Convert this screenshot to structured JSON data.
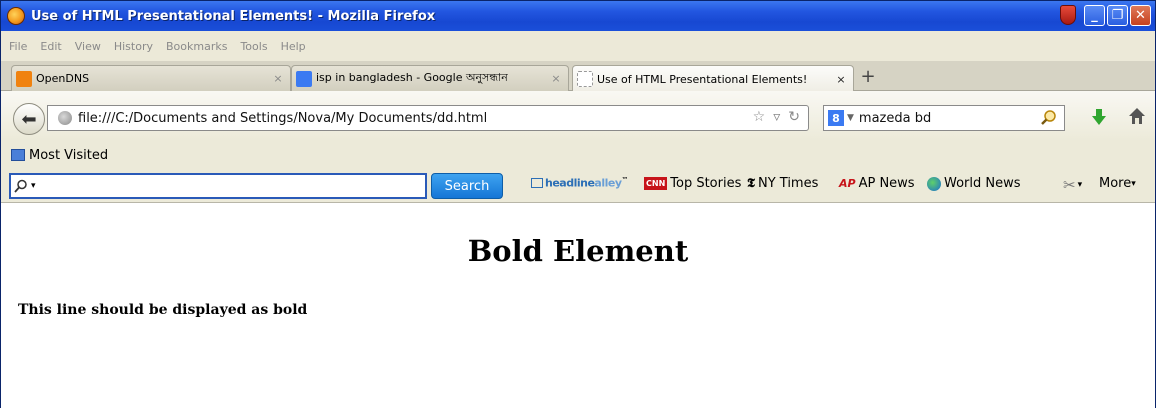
{
  "window": {
    "title": "Use of HTML Presentational Elements! - Mozilla Firefox"
  },
  "menu": {
    "items": [
      "File",
      "Edit",
      "View",
      "History",
      "Bookmarks",
      "Tools",
      "Help"
    ]
  },
  "tabs": [
    {
      "label": "OpenDNS",
      "close": "×"
    },
    {
      "label": "isp in bangladesh - Google অনুসন্ধান",
      "close": "×"
    },
    {
      "label": "Use of HTML Presentational Elements!",
      "close": "×"
    }
  ],
  "newtab": "+",
  "nav": {
    "url": "file:///C:/Documents and Settings/Nova/My Documents/dd.html",
    "search_engine": "8",
    "search_value": "mazeda bd"
  },
  "bookmarks": {
    "most_visited": "Most Visited"
  },
  "toolbar": {
    "search_drop": "▾",
    "search_button": "Search",
    "headline_a": "headline",
    "headline_b": "alley",
    "headline_tm": "™",
    "cnn_badge": "CNN",
    "top_stories": "Top Stories",
    "nyt_glyph": "𝕿",
    "ny_times": "NY Times",
    "ap_badge": "AP",
    "ap_news": "AP News",
    "world_news": "World News",
    "more": "More"
  },
  "content": {
    "heading": "Bold Element",
    "paragraph": "This line should be displayed as bold"
  },
  "colors": {
    "titlebar": "#1748d2",
    "search_button": "#1576d6"
  }
}
